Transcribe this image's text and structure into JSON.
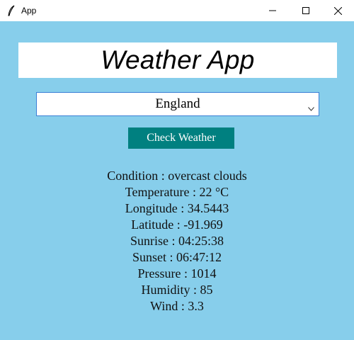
{
  "window": {
    "title": "App",
    "controls": {
      "minimize": "minimize-icon",
      "maximize": "maximize-icon",
      "close": "close-icon"
    }
  },
  "header": {
    "title": "Weather App"
  },
  "country_select": {
    "selected": "England"
  },
  "check_button": {
    "label": "Check Weather"
  },
  "results": {
    "condition": "Condition : overcast clouds",
    "temperature": "Temperature : 22 °C",
    "longitude": "Longitude : 34.5443",
    "latitude": "Latitude : -91.969",
    "sunrise": "Sunrise : 04:25:38",
    "sunset": "Sunset : 06:47:12",
    "pressure": "Pressure : 1014",
    "humidity": "Humidity : 85",
    "wind": "Wind : 3.3"
  },
  "colors": {
    "background": "#87ceeb",
    "button": "#008080",
    "button_text": "#ffffff",
    "dropdown_border": "#3b7fd6"
  }
}
